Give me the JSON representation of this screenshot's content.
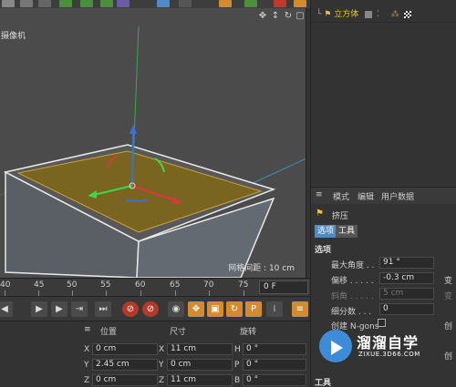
{
  "viewport": {
    "camera_label": "摄像机",
    "grid_spacing": "网格间距 : 10 cm"
  },
  "timeline": {
    "ticks": [
      "40",
      "45",
      "50",
      "55",
      "60",
      "65",
      "70",
      "75"
    ],
    "current_frame": "0 F"
  },
  "objects": {
    "object_name": "立方体"
  },
  "attributes": {
    "menu": [
      "模式",
      "编辑",
      "用户数据"
    ],
    "object_title": "挤压",
    "tabs": [
      "选项",
      "工具"
    ],
    "section_options": "选项",
    "props": [
      {
        "label": "最大角度 . .",
        "value": "91 °",
        "disabled": false
      },
      {
        "label": "偏移 . . . . .",
        "value": "-0.3 cm",
        "disabled": false
      },
      {
        "label": "斜角 . . . . .",
        "value": "5 cm",
        "disabled": true
      },
      {
        "label": "细分数 . . .",
        "value": "0",
        "disabled": false
      }
    ],
    "ngons_label": "创建 N-gons",
    "right_clipped": [
      "变",
      "变",
      "创",
      "创"
    ],
    "section_tools": "工具"
  },
  "coords": {
    "headers": {
      "position": "位置",
      "size": "尺寸",
      "rotation": "旋转"
    },
    "rows": [
      {
        "pos_axis": "X",
        "pos": "0 cm",
        "size_axis": "X",
        "size": "11 cm",
        "rot_axis": "H",
        "rot": "0 °"
      },
      {
        "pos_axis": "Y",
        "pos": "2.45 cm",
        "size_axis": "Y",
        "size": "0 cm",
        "rot_axis": "P",
        "rot": "0 °"
      },
      {
        "pos_axis": "Z",
        "pos": "0 cm",
        "size_axis": "Z",
        "size": "11 cm",
        "rot_axis": "B",
        "rot": "0 °"
      }
    ]
  },
  "watermark": {
    "title": "溜溜自学",
    "subtitle": "ZIXUE.3D66.COM"
  },
  "colors": {
    "accent_blue": "#4f8bc9",
    "selection_orange": "#d48a2e",
    "object_yellow": "#e8c23c",
    "extrude_face": "#7a6520"
  }
}
